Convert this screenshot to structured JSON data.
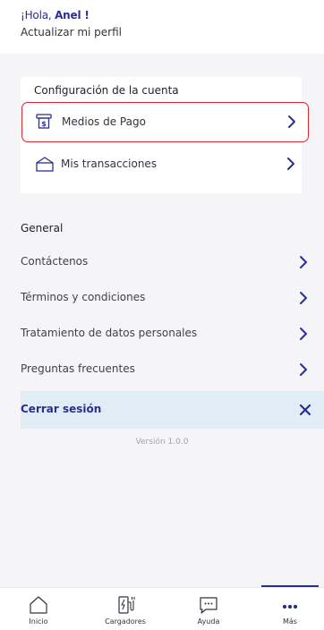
{
  "header": {
    "greeting_prefix": "¡Hola, ",
    "user_name": "Anel !",
    "update_profile": "Actualizar mi perfil"
  },
  "account_settings": {
    "title": "Configuración de la cuenta",
    "items": [
      {
        "label": "Medios de Pago",
        "icon": "payment-card-icon",
        "highlighted": true
      },
      {
        "label": "Mis transacciones",
        "icon": "transactions-icon"
      }
    ]
  },
  "general": {
    "title": "General",
    "items": [
      {
        "label": "Contáctenos"
      },
      {
        "label": "Términos y condiciones"
      },
      {
        "label": "Tratamiento de datos personales"
      },
      {
        "label": "Preguntas frecuentes"
      }
    ],
    "logout_label": "Cerrar sesión"
  },
  "version": "Versión 1.0.0",
  "bottom_nav": {
    "items": [
      {
        "label": "Inicio",
        "icon": "home-icon"
      },
      {
        "label": "Cargadores",
        "icon": "charger-icon"
      },
      {
        "label": "Ayuda",
        "icon": "chat-icon"
      },
      {
        "label": "Más",
        "icon": "more-dots-icon",
        "active": true
      }
    ]
  },
  "colors": {
    "brand": "#2a2f8f",
    "highlight_border": "#e0242f",
    "logout_bg": "#e1edf5",
    "page_bg": "#f5f5f8"
  }
}
